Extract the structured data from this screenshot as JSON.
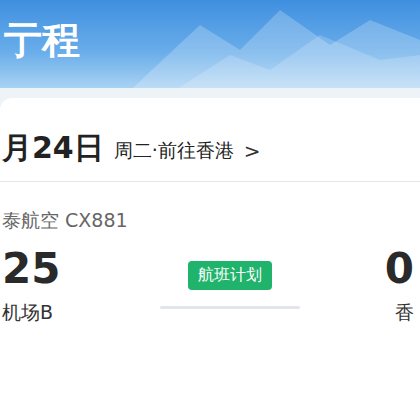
{
  "header": {
    "title": "亍程"
  },
  "trip": {
    "date": "月24日",
    "subtitle": "周二·前往香港",
    "chevron": ">"
  },
  "flight": {
    "airline": "泰航空 CX881",
    "badge": "航班计划",
    "departure": {
      "time": "25",
      "airport": "机场B"
    },
    "arrival": {
      "time": "0",
      "airport": "香"
    }
  }
}
